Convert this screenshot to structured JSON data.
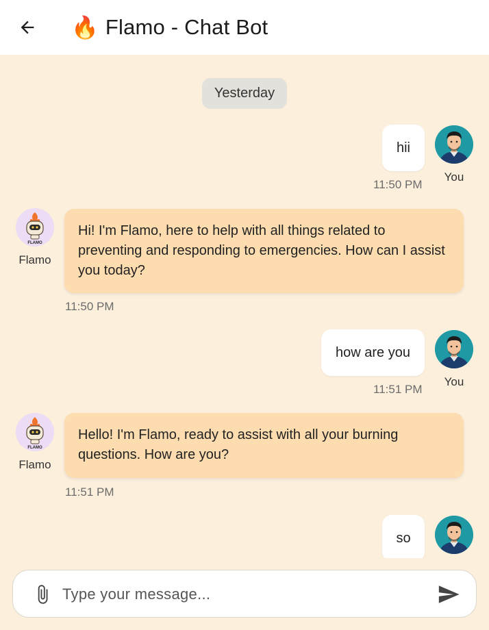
{
  "header": {
    "title": "Flamo - Chat Bot",
    "title_emoji": "🔥",
    "back_icon": "arrow-left-icon"
  },
  "chat": {
    "date_separator": "Yesterday",
    "messages": [
      {
        "sender": "user",
        "text": "hii",
        "time": "11:50 PM",
        "label": "You"
      },
      {
        "sender": "bot",
        "text": "Hi!  I'm Flamo, here to help with all things related to preventing and responding to emergencies.  How can I assist you today?",
        "time": "11:50 PM",
        "label": "Flamo"
      },
      {
        "sender": "user",
        "text": "how are you",
        "time": "11:51 PM",
        "label": "You"
      },
      {
        "sender": "bot",
        "text": "Hello! I'm Flamo, ready to assist with all your burning questions. How are you?",
        "time": "11:51 PM",
        "label": "Flamo"
      },
      {
        "sender": "user",
        "text": "so",
        "time": "",
        "label": ""
      }
    ],
    "bot_logo_text": "FLAMO"
  },
  "composer": {
    "placeholder": "Type your message...",
    "attach_icon": "paperclip-icon",
    "send_icon": "send-icon"
  },
  "colors": {
    "background": "#fcefdc",
    "appbar": "#ffffff",
    "user_bubble": "#ffffff",
    "bot_bubble": "#fddcb0",
    "date_chip": "#e3e1dc",
    "user_avatar_bg": "#1f9aa5",
    "bot_avatar_bg": "#ecdcf5"
  }
}
